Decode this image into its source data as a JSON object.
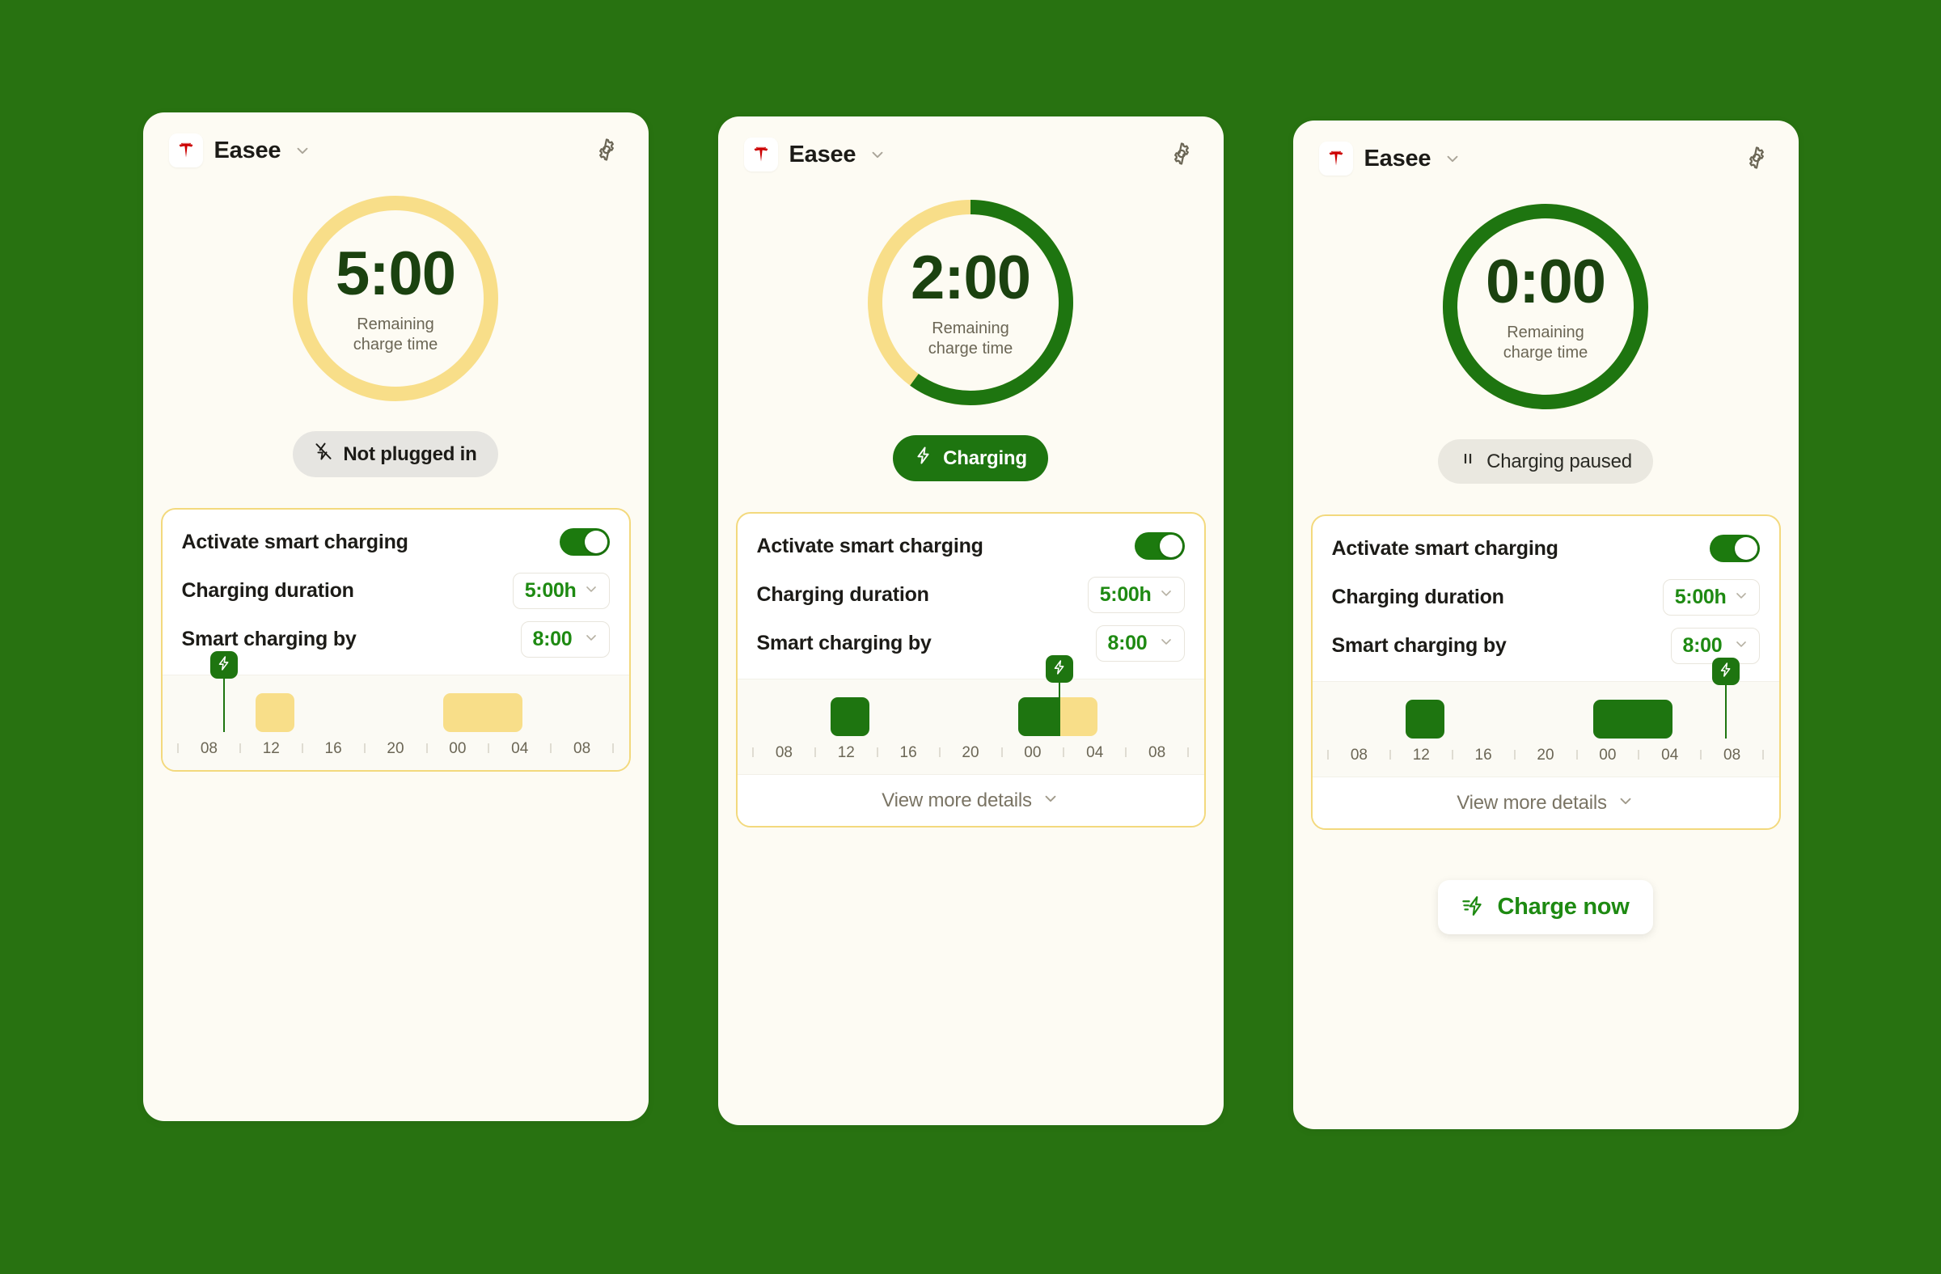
{
  "theme": {
    "page_background": "#287211",
    "card_background": "#FDFBF3",
    "green": "#1E7510",
    "green_bright": "#1E8A12",
    "green_dark": "#1B4210",
    "yellow": "#F8DE89",
    "yellow_border": "#F3D97D",
    "tesla_red": "#CC0000",
    "muted_text": "#6B6655"
  },
  "cards": [
    {
      "header": {
        "logo_icon": "tesla-logo-icon",
        "brand": "Easee",
        "chevron_icon": "chevron-down-icon",
        "settings_icon": "gear-icon"
      },
      "donut": {
        "time": "5:00",
        "sub_line1": "Remaining",
        "sub_line2": "charge time",
        "green_fraction": 0.0,
        "track_color": "#F8DE89",
        "progress_color": "#1E7510"
      },
      "status": {
        "label": "Not plugged in",
        "icon": "plug-disconnected-icon",
        "style": "grey"
      },
      "panel": {
        "toggle_label": "Activate smart charging",
        "toggle_on": true,
        "duration_label": "Charging duration",
        "duration_value": "5:00h",
        "by_label": "Smart charging by",
        "by_value": "8:00",
        "chevron_icon": "chevron-down-icon"
      },
      "chart_data": {
        "type": "bar",
        "title": "Smart charging schedule",
        "xlabel": "",
        "ylabel": "",
        "grid": false,
        "legend": "none",
        "axis_ticks": [
          "08",
          "12",
          "16",
          "20",
          "00",
          "04",
          "08"
        ],
        "tick_positions_pct": [
          8.3,
          22.2,
          36.1,
          50.0,
          63.9,
          77.8,
          91.7
        ],
        "minor_tick_positions_pct": [
          1.4,
          15.3,
          29.2,
          43.1,
          57.0,
          70.8,
          84.7,
          98.6
        ],
        "marker": {
          "label": "charge-marker",
          "position_pct": 10.0,
          "icon": "bolt-icon"
        },
        "bars": [
          {
            "start_pct": 17.5,
            "end_pct": 26.5,
            "segments": [
              {
                "color": "yellow",
                "width_pct": 100
              }
            ]
          },
          {
            "start_pct": 61.0,
            "end_pct": 79.5,
            "segments": [
              {
                "color": "yellow",
                "width_pct": 100
              }
            ]
          }
        ]
      },
      "details": null,
      "cta": null
    },
    {
      "header": {
        "logo_icon": "tesla-logo-icon",
        "brand": "Easee",
        "chevron_icon": "chevron-down-icon",
        "settings_icon": "gear-icon"
      },
      "donut": {
        "time": "2:00",
        "sub_line1": "Remaining",
        "sub_line2": "charge time",
        "green_fraction": 0.6,
        "track_color": "#F8DE89",
        "progress_color": "#1E7510"
      },
      "status": {
        "label": "Charging",
        "icon": "bolt-icon",
        "style": "green"
      },
      "panel": {
        "toggle_label": "Activate smart charging",
        "toggle_on": true,
        "duration_label": "Charging duration",
        "duration_value": "5:00h",
        "by_label": "Smart charging by",
        "by_value": "8:00",
        "chevron_icon": "chevron-down-icon"
      },
      "chart_data": {
        "type": "bar",
        "title": "Smart charging schedule",
        "xlabel": "",
        "ylabel": "",
        "grid": false,
        "legend": "none",
        "axis_ticks": [
          "08",
          "12",
          "16",
          "20",
          "00",
          "04",
          "08"
        ],
        "tick_positions_pct": [
          8.3,
          22.2,
          36.1,
          50.0,
          63.9,
          77.8,
          91.7
        ],
        "minor_tick_positions_pct": [
          1.4,
          15.3,
          29.2,
          43.1,
          57.0,
          70.8,
          84.7,
          98.6
        ],
        "marker": {
          "label": "charge-marker",
          "position_pct": 70.5,
          "icon": "bolt-icon"
        },
        "bars": [
          {
            "start_pct": 17.5,
            "end_pct": 26.5,
            "segments": [
              {
                "color": "green",
                "width_pct": 100
              }
            ]
          },
          {
            "start_pct": 61.0,
            "end_pct": 79.5,
            "segments": [
              {
                "color": "green",
                "width_pct": 51
              },
              {
                "color": "yellow",
                "width_pct": 49
              }
            ]
          }
        ]
      },
      "details": {
        "label": "View more details",
        "chevron_icon": "chevron-down-icon"
      },
      "cta": null
    },
    {
      "header": {
        "logo_icon": "tesla-logo-icon",
        "brand": "Easee",
        "chevron_icon": "chevron-down-icon",
        "settings_icon": "gear-icon"
      },
      "donut": {
        "time": "0:00",
        "sub_line1": "Remaining",
        "sub_line2": "charge time",
        "green_fraction": 1.0,
        "track_color": "#F8DE89",
        "progress_color": "#1E7510"
      },
      "status": {
        "label": "Charging paused",
        "icon": "pause-icon",
        "style": "paused"
      },
      "panel": {
        "toggle_label": "Activate smart charging",
        "toggle_on": true,
        "duration_label": "Charging duration",
        "duration_value": "5:00h",
        "by_label": "Smart charging by",
        "by_value": "8:00",
        "chevron_icon": "chevron-down-icon"
      },
      "chart_data": {
        "type": "bar",
        "title": "Smart charging schedule",
        "xlabel": "",
        "ylabel": "",
        "grid": false,
        "legend": "none",
        "axis_ticks": [
          "08",
          "12",
          "16",
          "20",
          "00",
          "04",
          "08"
        ],
        "tick_positions_pct": [
          8.3,
          22.2,
          36.1,
          50.0,
          63.9,
          77.8,
          91.7
        ],
        "minor_tick_positions_pct": [
          1.4,
          15.3,
          29.2,
          43.1,
          57.0,
          70.8,
          84.7,
          98.6
        ],
        "marker": {
          "label": "charge-marker",
          "position_pct": 91.7,
          "icon": "bolt-icon"
        },
        "bars": [
          {
            "start_pct": 17.5,
            "end_pct": 26.5,
            "segments": [
              {
                "color": "green",
                "width_pct": 100
              }
            ]
          },
          {
            "start_pct": 61.0,
            "end_pct": 79.5,
            "segments": [
              {
                "color": "green",
                "width_pct": 100
              }
            ]
          }
        ]
      },
      "details": {
        "label": "View more details",
        "chevron_icon": "chevron-down-icon"
      },
      "cta": {
        "label": "Charge now",
        "icon": "fast-charge-icon"
      }
    }
  ]
}
